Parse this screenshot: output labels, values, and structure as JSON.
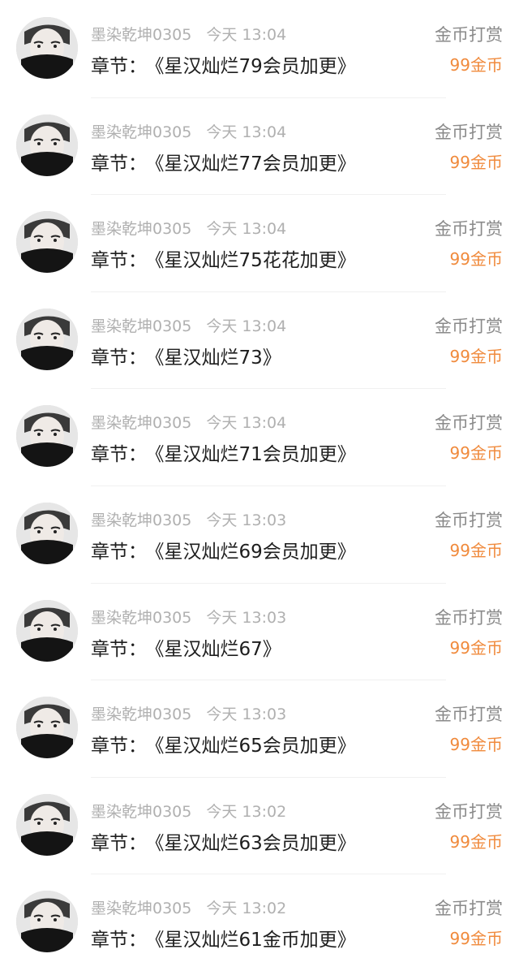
{
  "records": [
    {
      "user": "墨染乾坤0305",
      "time": "今天 13:04",
      "chapter_prefix": "章节：",
      "chapter_title": "《星汉灿烂79会员加更》",
      "type": "金币打赏",
      "amount": "99金币"
    },
    {
      "user": "墨染乾坤0305",
      "time": "今天 13:04",
      "chapter_prefix": "章节：",
      "chapter_title": "《星汉灿烂77会员加更》",
      "type": "金币打赏",
      "amount": "99金币"
    },
    {
      "user": "墨染乾坤0305",
      "time": "今天 13:04",
      "chapter_prefix": "章节：",
      "chapter_title": "《星汉灿烂75花花加更》",
      "type": "金币打赏",
      "amount": "99金币"
    },
    {
      "user": "墨染乾坤0305",
      "time": "今天 13:04",
      "chapter_prefix": "章节：",
      "chapter_title": "《星汉灿烂73》",
      "type": "金币打赏",
      "amount": "99金币"
    },
    {
      "user": "墨染乾坤0305",
      "time": "今天 13:04",
      "chapter_prefix": "章节：",
      "chapter_title": "《星汉灿烂71会员加更》",
      "type": "金币打赏",
      "amount": "99金币"
    },
    {
      "user": "墨染乾坤0305",
      "time": "今天 13:03",
      "chapter_prefix": "章节：",
      "chapter_title": "《星汉灿烂69会员加更》",
      "type": "金币打赏",
      "amount": "99金币"
    },
    {
      "user": "墨染乾坤0305",
      "time": "今天 13:03",
      "chapter_prefix": "章节：",
      "chapter_title": "《星汉灿烂67》",
      "type": "金币打赏",
      "amount": "99金币"
    },
    {
      "user": "墨染乾坤0305",
      "time": "今天 13:03",
      "chapter_prefix": "章节：",
      "chapter_title": "《星汉灿烂65会员加更》",
      "type": "金币打赏",
      "amount": "99金币"
    },
    {
      "user": "墨染乾坤0305",
      "time": "今天 13:02",
      "chapter_prefix": "章节：",
      "chapter_title": "《星汉灿烂63会员加更》",
      "type": "金币打赏",
      "amount": "99金币"
    },
    {
      "user": "墨染乾坤0305",
      "time": "今天 13:02",
      "chapter_prefix": "章节：",
      "chapter_title": "《星汉灿烂61金币加更》",
      "type": "金币打赏",
      "amount": "99金币"
    }
  ],
  "colors": {
    "amount": "#f08a3c",
    "meta": "#b0b0b0",
    "type": "#8a8a8a",
    "chapter": "#1e1e1e"
  },
  "icons": {
    "avatar": "user-avatar-icon"
  }
}
